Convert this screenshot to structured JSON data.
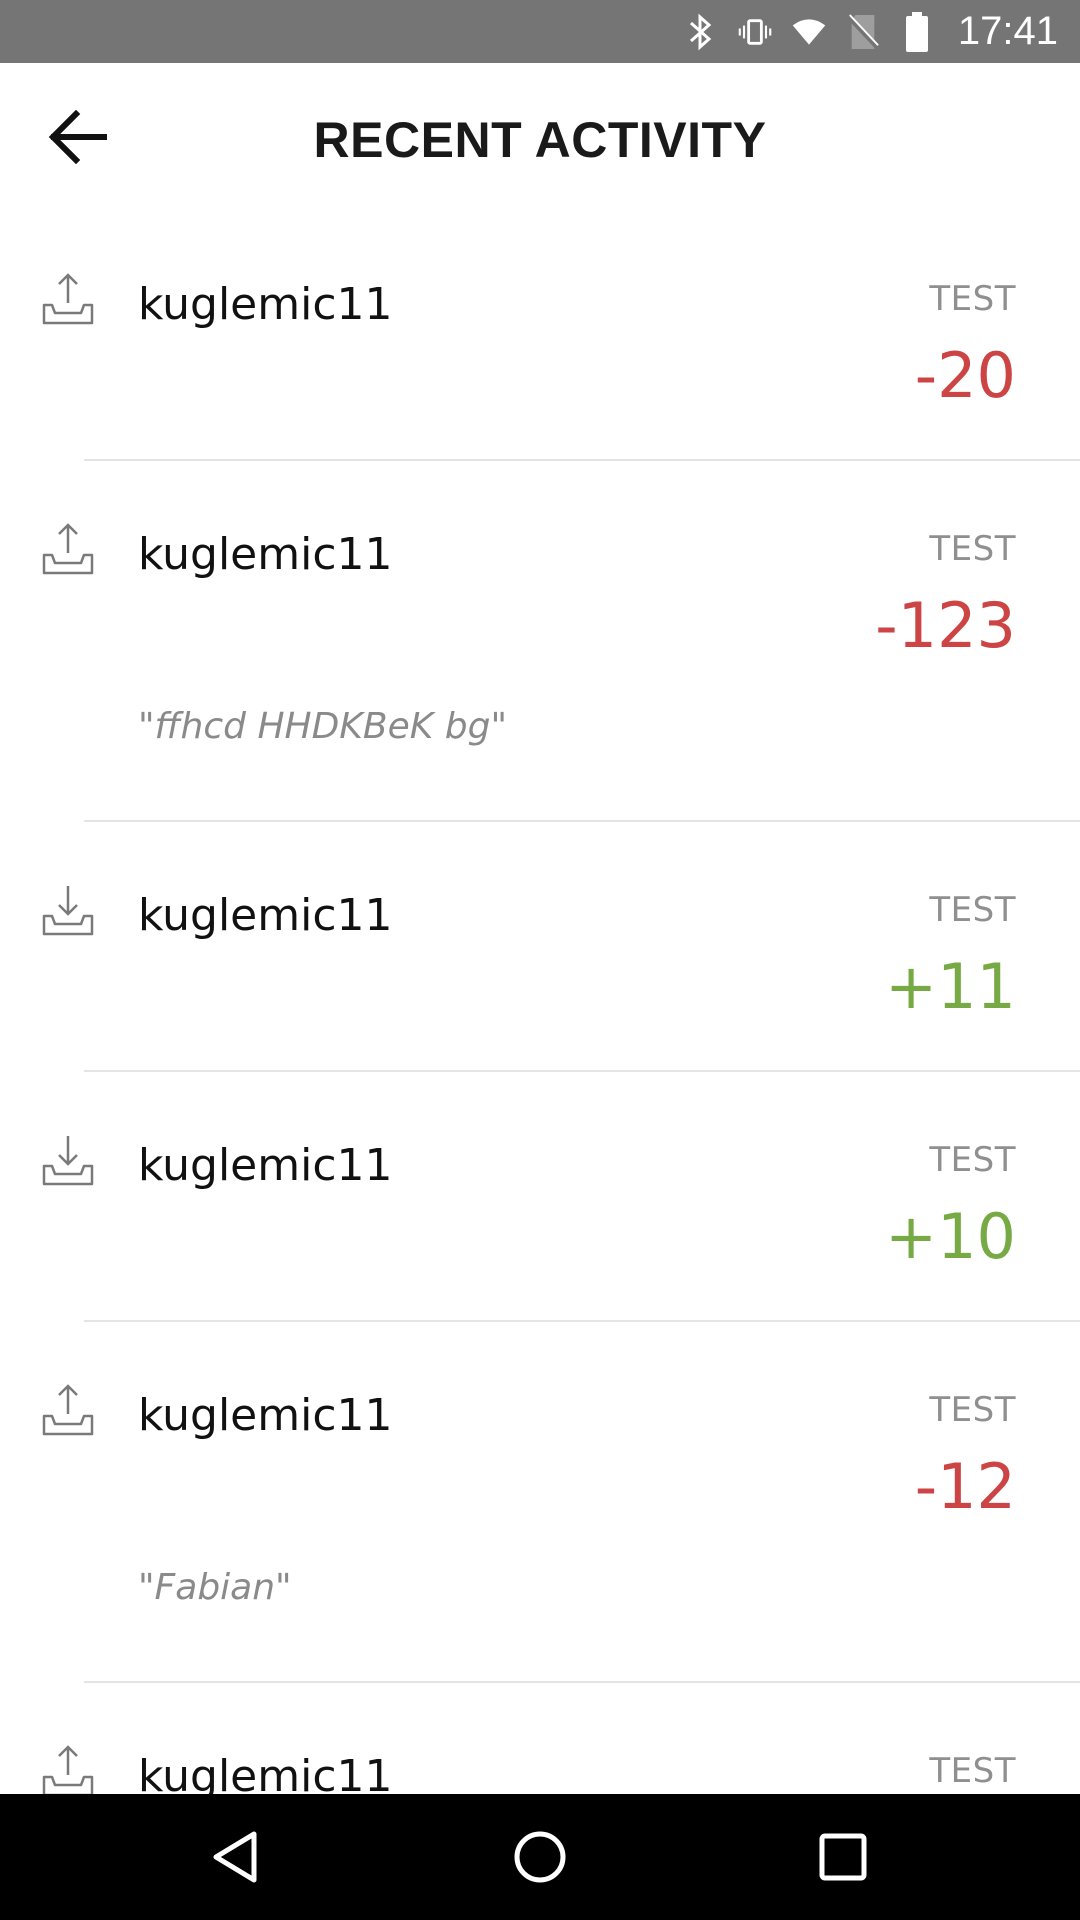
{
  "status_bar": {
    "time": "17:41",
    "icons": [
      "bluetooth-icon",
      "vibrate-icon",
      "wifi-icon",
      "no-sim-icon",
      "battery-icon"
    ]
  },
  "header": {
    "title": "RECENT ACTIVITY",
    "back_icon": "arrow-left-icon"
  },
  "colors": {
    "negative": "#cc4444",
    "positive": "#77aa44",
    "muted": "#8f8f8f",
    "status_bar_bg": "#757575",
    "nav_bar_bg": "#000000"
  },
  "activity": [
    {
      "direction": "outgoing",
      "icon": "tray-upload-icon",
      "user": "kuglemic11",
      "currency": "TEST",
      "amount": "-20",
      "note": ""
    },
    {
      "direction": "outgoing",
      "icon": "tray-upload-icon",
      "user": "kuglemic11",
      "currency": "TEST",
      "amount": "-123",
      "note": "\"ffhcd HHDKBeK bg\""
    },
    {
      "direction": "incoming",
      "icon": "tray-download-icon",
      "user": "kuglemic11",
      "currency": "TEST",
      "amount": "+11",
      "note": ""
    },
    {
      "direction": "incoming",
      "icon": "tray-download-icon",
      "user": "kuglemic11",
      "currency": "TEST",
      "amount": "+10",
      "note": ""
    },
    {
      "direction": "outgoing",
      "icon": "tray-upload-icon",
      "user": "kuglemic11",
      "currency": "TEST",
      "amount": "-12",
      "note": "\"Fabian\""
    },
    {
      "direction": "outgoing",
      "icon": "tray-upload-icon",
      "user": "kuglemic11",
      "currency": "TEST",
      "amount": "",
      "note": ""
    }
  ],
  "nav_bar": {
    "buttons": [
      "back-triangle-icon",
      "home-circle-icon",
      "recents-square-icon"
    ]
  }
}
